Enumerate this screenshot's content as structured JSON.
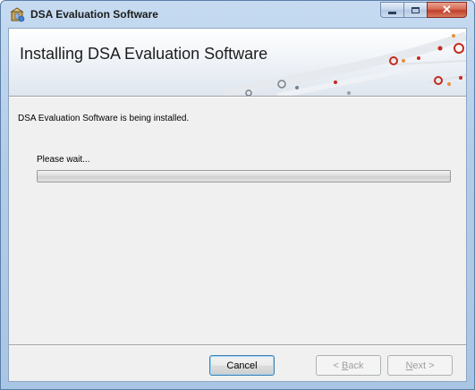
{
  "window": {
    "title": "DSA Evaluation Software",
    "app_icon": "installer-box-icon",
    "caption_buttons": {
      "minimize": "minimize-icon",
      "maximize": "maximize-icon",
      "close": "close-icon"
    }
  },
  "banner": {
    "title": "Installing DSA Evaluation Software",
    "art": "circuit-dots-graphic"
  },
  "main": {
    "status": "DSA Evaluation Software is being installed.",
    "wait_label": "Please wait...",
    "progress": 0
  },
  "footer": {
    "cancel_label": "Cancel",
    "back_prefix": "< ",
    "back_accel": "B",
    "back_rest": "ack",
    "next_accel": "N",
    "next_rest": "ext >"
  },
  "colors": {
    "close_button": "#c0412a",
    "title_bar": "#b3cce8",
    "circuit_red": "#c42b1c",
    "circuit_orange": "#e8903a",
    "progress_green": "#22b21a"
  }
}
